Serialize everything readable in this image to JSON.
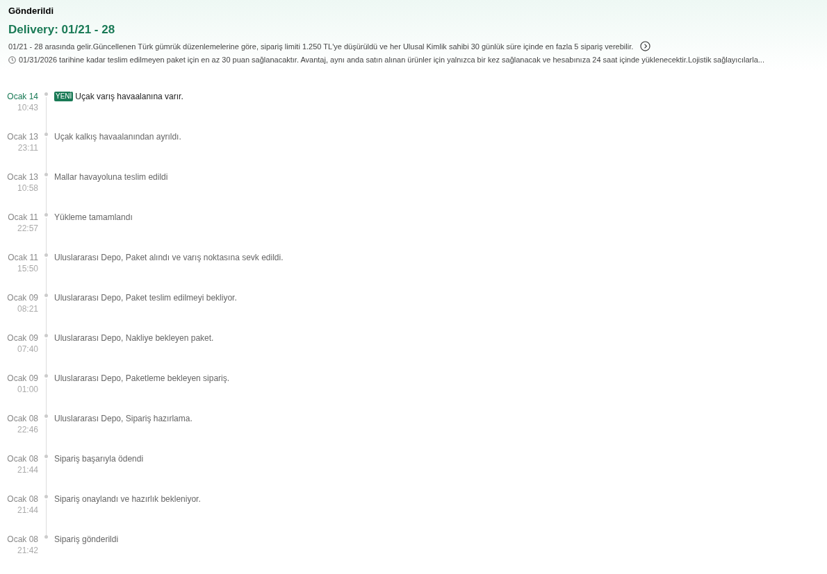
{
  "status_title": "Gönderildi",
  "delivery_title": "Delivery: 01/21 - 28",
  "notice": "01/21 - 28 arasında gelir.Güncellenen Türk gümrük düzenlemelerine göre, sipariş limiti 1.250 TL'ye düşürüldü ve her Ulusal Kimlik sahibi 30 günlük süre içinde en fazla 5 sipariş verebilir.",
  "points_note": "01/31/2026 tarihine kadar teslim edilmeyen paket için en az 30 puan sağlanacaktır. Avantaj, aynı anda satın alınan ürünler için yalnızca bir kez sağlanacak ve hesabınıza 24 saat içinde yüklenecektir.Lojistik sağlayıcılarla...",
  "events": [
    {
      "date": "Ocak 14",
      "time": "10:43",
      "badge": "YENİ",
      "text": "Uçak varış havaalanına varır.",
      "current": true
    },
    {
      "date": "Ocak 13",
      "time": "23:11",
      "text": "Uçak kalkış havaalanından ayrıldı.",
      "current": false
    },
    {
      "date": "Ocak 13",
      "time": "10:58",
      "text": "Mallar havayoluna teslim edildi",
      "current": false
    },
    {
      "date": "Ocak 11",
      "time": "22:57",
      "text": "Yükleme tamamlandı",
      "current": false
    },
    {
      "date": "Ocak 11",
      "time": "15:50",
      "text": "Uluslararası Depo, Paket alındı ve varış noktasına sevk edildi.",
      "current": false
    },
    {
      "date": "Ocak 09",
      "time": "08:21",
      "text": "Uluslararası Depo, Paket teslim edilmeyi bekliyor.",
      "current": false
    },
    {
      "date": "Ocak 09",
      "time": "07:40",
      "text": "Uluslararası Depo, Nakliye bekleyen paket.",
      "current": false
    },
    {
      "date": "Ocak 09",
      "time": "01:00",
      "text": "Uluslararası Depo, Paketleme bekleyen sipariş.",
      "current": false
    },
    {
      "date": "Ocak 08",
      "time": "22:46",
      "text": "Uluslararası Depo, Sipariş hazırlama.",
      "current": false
    },
    {
      "date": "Ocak 08",
      "time": "21:44",
      "text": "Sipariş başarıyla ödendi",
      "current": false
    },
    {
      "date": "Ocak 08",
      "time": "21:44",
      "text": "Sipariş onaylandı ve hazırlık bekleniyor.",
      "current": false
    },
    {
      "date": "Ocak 08",
      "time": "21:42",
      "text": "Sipariş gönderildi",
      "current": false
    }
  ]
}
